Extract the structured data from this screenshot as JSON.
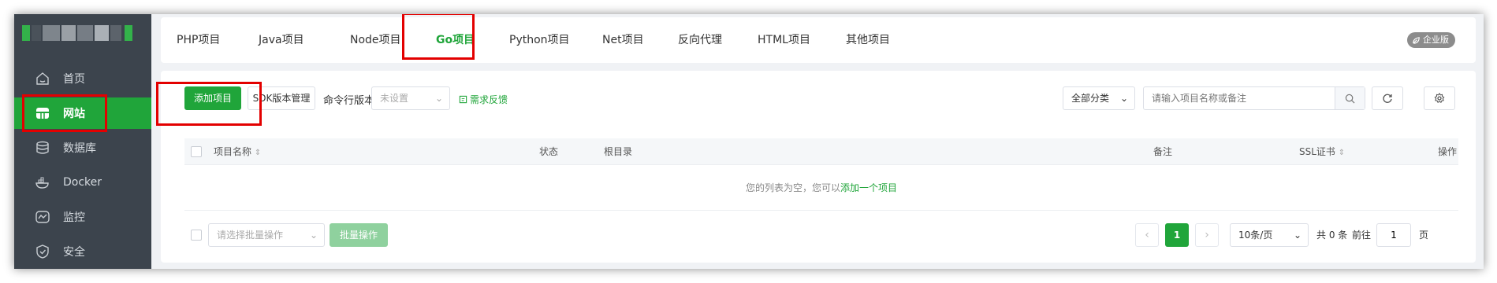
{
  "sidebar": {
    "items": [
      {
        "label": "首页",
        "icon": "home-icon"
      },
      {
        "label": "网站",
        "icon": "globe-icon",
        "active": true
      },
      {
        "label": "数据库",
        "icon": "database-icon"
      },
      {
        "label": "Docker",
        "icon": "docker-icon"
      },
      {
        "label": "监控",
        "icon": "monitor-icon"
      },
      {
        "label": "安全",
        "icon": "shield-icon"
      }
    ]
  },
  "tabs": [
    {
      "label": "PHP项目"
    },
    {
      "label": "Java项目"
    },
    {
      "label": "Node项目"
    },
    {
      "label": "Go项目",
      "active": true
    },
    {
      "label": "Python项目"
    },
    {
      "label": "Net项目"
    },
    {
      "label": "反向代理"
    },
    {
      "label": "HTML项目"
    },
    {
      "label": "其他项目"
    }
  ],
  "edition_badge": "企业版",
  "toolbar": {
    "add_label": "添加项目",
    "sdk_label": "SDK版本管理",
    "cli_label": "命令行版本",
    "cli_value": "未设置",
    "feedback_label": "需求反馈",
    "category_value": "全部分类",
    "search_placeholder": "请输入项目名称或备注"
  },
  "table": {
    "columns": [
      "项目名称",
      "状态",
      "根目录",
      "备注",
      "SSL证书",
      "操作"
    ],
    "empty_prefix": "您的列表为空，您可以",
    "empty_link": "添加一个项目"
  },
  "footer": {
    "batch_placeholder": "请选择批量操作",
    "batch_button": "批量操作",
    "current_page": "1",
    "page_size": "10条/页",
    "total_text": "共 0 条",
    "goto_label": "前往",
    "goto_value": "1",
    "page_suffix": "页"
  },
  "colors": {
    "accent": "#20a53a",
    "sidebar_bg": "#3c444d",
    "highlight": "#e30000"
  }
}
